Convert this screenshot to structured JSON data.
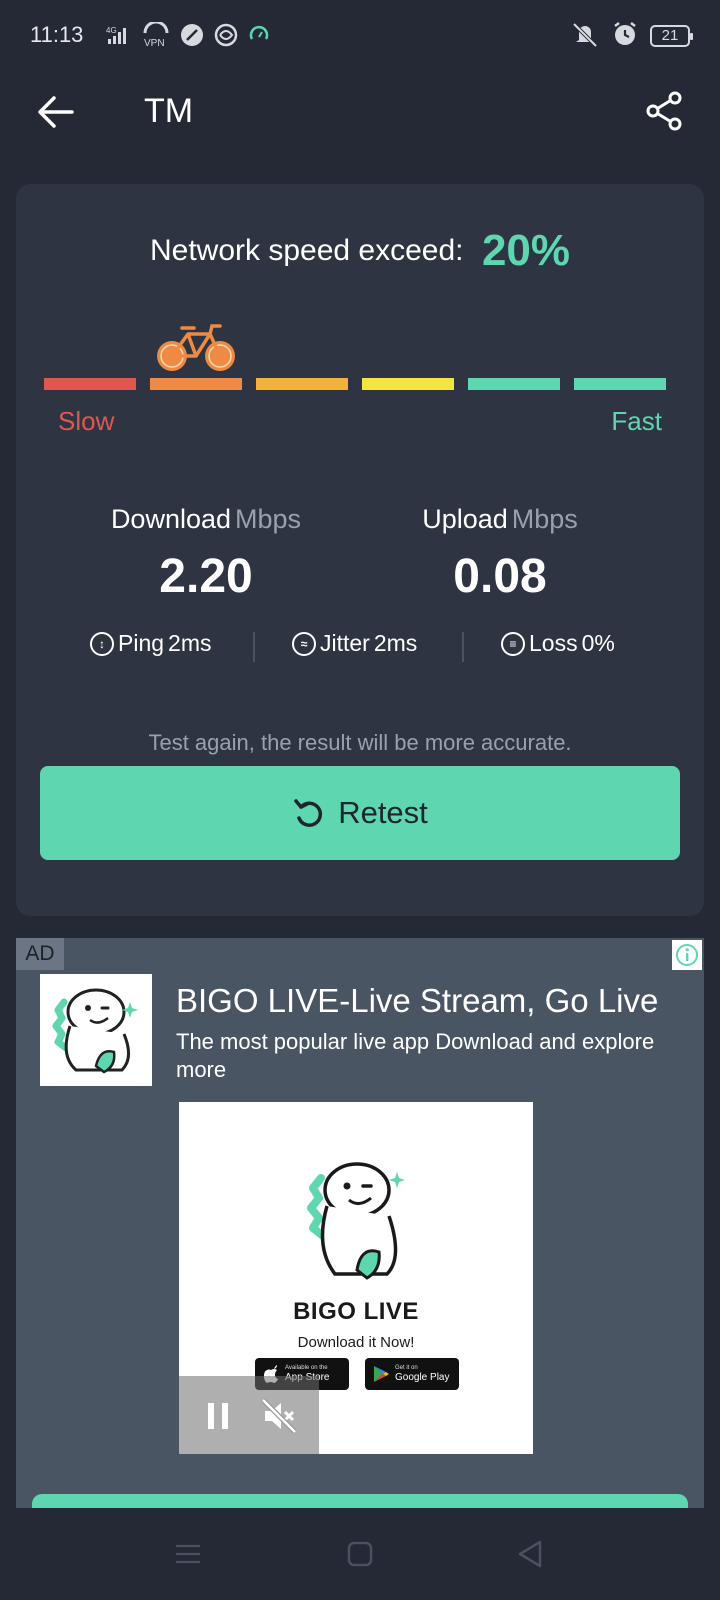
{
  "status_bar": {
    "time": "11:13",
    "network_badge": "4G",
    "vpn_label": "VPN",
    "battery_level": "21",
    "icons": [
      "signal-icon",
      "vpn-icon",
      "edit-icon",
      "data-saver-icon",
      "speed-icon",
      "mute-icon",
      "alarm-icon",
      "battery-icon"
    ]
  },
  "app_bar": {
    "title": "TM"
  },
  "result": {
    "exceed_label": "Network speed exceed:",
    "exceed_value": "20%",
    "exceed_fraction": 0.2,
    "meter_slow_label": "Slow",
    "meter_fast_label": "Fast",
    "meter_colors": [
      "#e0574f",
      "#ef8a45",
      "#f3b23b",
      "#f4e442",
      "#5ed6b0",
      "#5ed6b0"
    ],
    "active_segment": 2,
    "download": {
      "label": "Download",
      "unit": "Mbps",
      "value": "2.20"
    },
    "upload": {
      "label": "Upload",
      "unit": "Mbps",
      "value": "0.08"
    },
    "ping": {
      "label": "Ping",
      "value": "2ms"
    },
    "jitter": {
      "label": "Jitter",
      "value": "2ms"
    },
    "loss": {
      "label": "Loss",
      "value": "0%"
    },
    "hint": "Test again, the result will be more accurate.",
    "retest_label": "Retest"
  },
  "ad": {
    "badge": "AD",
    "title": "BIGO LIVE-Live Stream, Go Live",
    "description": "The most popular live app Download and explore more",
    "media_brand": "BIGO LIVE",
    "media_cta": "Download it Now!",
    "app_store_small": "Available on the",
    "app_store_big": "App Store",
    "google_play_small": "Get it on",
    "google_play_big": "Google Play"
  },
  "colors": {
    "accent": "#5ed6b0",
    "background": "#242935",
    "card": "#2e3442"
  }
}
